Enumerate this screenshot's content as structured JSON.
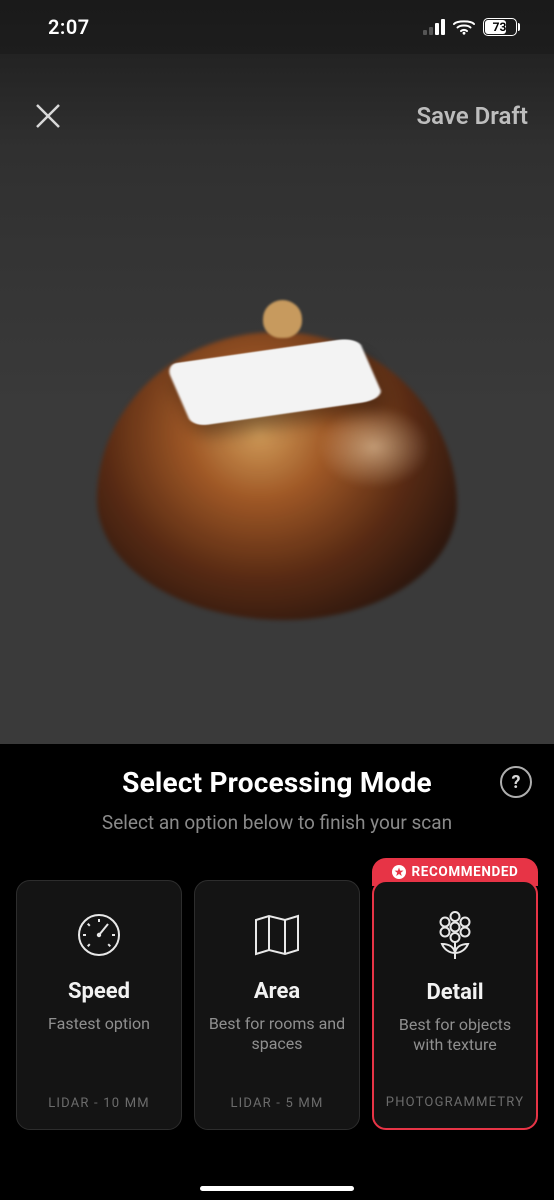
{
  "status": {
    "time": "2:07",
    "battery_pct": "73"
  },
  "topbar": {
    "save_draft_label": "Save Draft"
  },
  "sheet": {
    "title": "Select Processing Mode",
    "subtitle": "Select an option below to finish your scan",
    "help_symbol": "?",
    "recommended_label": "RECOMMENDED"
  },
  "modes": [
    {
      "name": "Speed",
      "description": "Fastest option",
      "meta": "LIDAR - 10 MM"
    },
    {
      "name": "Area",
      "description": "Best for rooms and spaces",
      "meta": "LIDAR - 5 MM"
    },
    {
      "name": "Detail",
      "description": "Best for objects with texture",
      "meta": "PHOTOGRAMMETRY"
    }
  ]
}
